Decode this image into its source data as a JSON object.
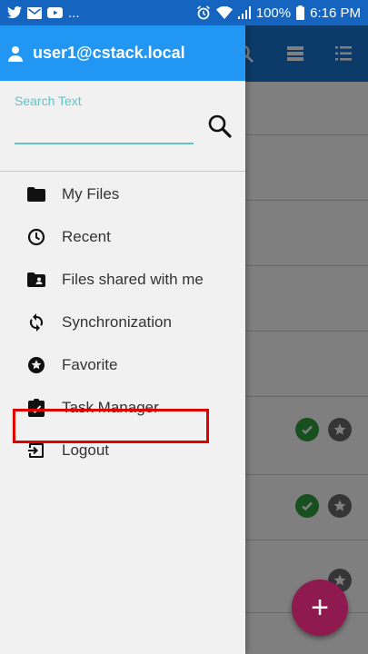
{
  "status_bar": {
    "battery": "100%",
    "time": "6:16 PM",
    "ellipsis": "..."
  },
  "drawer": {
    "user": "user1@cstack.local",
    "search": {
      "label": "Search Text",
      "value": ""
    },
    "menu": [
      {
        "label": "My Files",
        "icon": "folder-icon"
      },
      {
        "label": "Recent",
        "icon": "clock-icon"
      },
      {
        "label": "Files shared with me",
        "icon": "shared-folder-icon"
      },
      {
        "label": "Synchronization",
        "icon": "sync-icon"
      },
      {
        "label": "Favorite",
        "icon": "star-icon"
      },
      {
        "label": "Task Manager",
        "icon": "clipboard-check-icon"
      },
      {
        "label": "Logout",
        "icon": "logout-icon"
      }
    ]
  },
  "fab": {
    "label": "+"
  },
  "colors": {
    "drawer_header": "#2196f3",
    "accent": "#5fc3c8",
    "highlight": "#e00000",
    "fab": "#8e1a4f"
  }
}
